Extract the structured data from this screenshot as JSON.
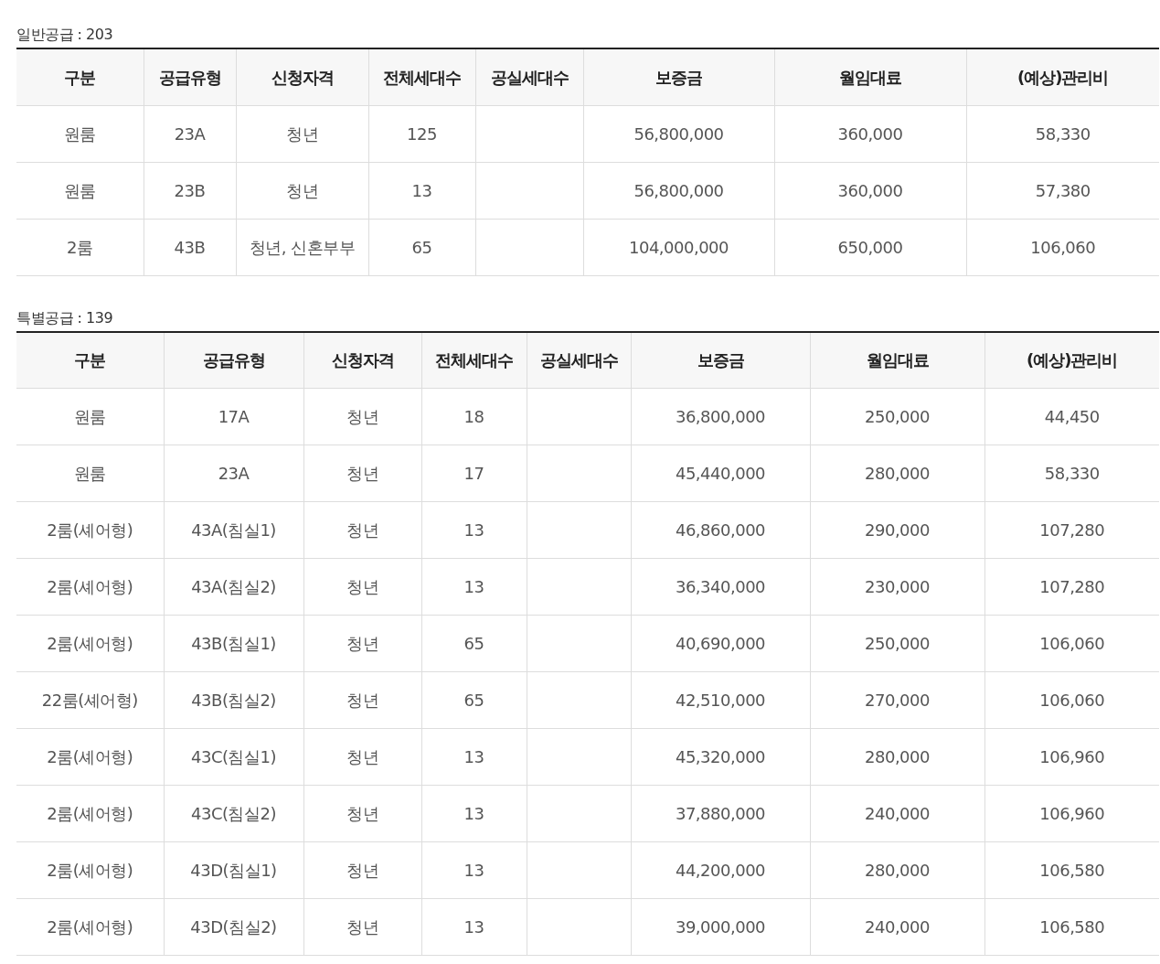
{
  "sections": [
    {
      "caption": "일반공급 : 203",
      "columns": [
        "구분",
        "공급유형",
        "신청자격",
        "전체세대수",
        "공실세대수",
        "보증금",
        "월임대료",
        "(예상)관리비"
      ],
      "rows": [
        {
          "category": "원룸",
          "supply_type": "23A",
          "eligibility": "청년",
          "total_units": "125",
          "deposit": "56,800,000",
          "monthly_rent": "360,000",
          "maintenance_fee": "58,330"
        },
        {
          "category": "원룸",
          "supply_type": "23B",
          "eligibility": "청년",
          "total_units": "13",
          "deposit": "56,800,000",
          "monthly_rent": "360,000",
          "maintenance_fee": "57,380"
        },
        {
          "category": "2룸",
          "supply_type": "43B",
          "eligibility": "청년, 신혼부부",
          "total_units": "65",
          "deposit": "104,000,000",
          "monthly_rent": "650,000",
          "maintenance_fee": "106,060"
        }
      ]
    },
    {
      "caption": "특별공급 : 139",
      "columns": [
        "구분",
        "공급유형",
        "신청자격",
        "전체세대수",
        "공실세대수",
        "보증금",
        "월임대료",
        "(예상)관리비"
      ],
      "rows": [
        {
          "category": "원룸",
          "supply_type": "17A",
          "eligibility": "청년",
          "total_units": "18",
          "deposit": "36,800,000",
          "monthly_rent": "250,000",
          "maintenance_fee": "44,450"
        },
        {
          "category": "원룸",
          "supply_type": "23A",
          "eligibility": "청년",
          "total_units": "17",
          "deposit": "45,440,000",
          "monthly_rent": "280,000",
          "maintenance_fee": "58,330"
        },
        {
          "category": "2룸(셰어형)",
          "supply_type": "43A(침실1)",
          "eligibility": "청년",
          "total_units": "13",
          "deposit": "46,860,000",
          "monthly_rent": "290,000",
          "maintenance_fee": "107,280"
        },
        {
          "category": "2룸(셰어형)",
          "supply_type": "43A(침실2)",
          "eligibility": "청년",
          "total_units": "13",
          "deposit": "36,340,000",
          "monthly_rent": "230,000",
          "maintenance_fee": "107,280"
        },
        {
          "category": "2룸(셰어형)",
          "supply_type": "43B(침실1)",
          "eligibility": "청년",
          "total_units": "65",
          "deposit": "40,690,000",
          "monthly_rent": "250,000",
          "maintenance_fee": "106,060"
        },
        {
          "category": "22룸(셰어형)",
          "supply_type": "43B(침실2)",
          "eligibility": "청년",
          "total_units": "65",
          "deposit": "42,510,000",
          "monthly_rent": "270,000",
          "maintenance_fee": "106,060"
        },
        {
          "category": "2룸(셰어형)",
          "supply_type": "43C(침실1)",
          "eligibility": "청년",
          "total_units": "13",
          "deposit": "45,320,000",
          "monthly_rent": "280,000",
          "maintenance_fee": "106,960"
        },
        {
          "category": "2룸(셰어형)",
          "supply_type": "43C(침실2)",
          "eligibility": "청년",
          "total_units": "13",
          "deposit": "37,880,000",
          "monthly_rent": "240,000",
          "maintenance_fee": "106,960"
        },
        {
          "category": "2룸(셰어형)",
          "supply_type": "43D(침실1)",
          "eligibility": "청년",
          "total_units": "13",
          "deposit": "44,200,000",
          "monthly_rent": "280,000",
          "maintenance_fee": "106,580"
        },
        {
          "category": "2룸(셰어형)",
          "supply_type": "43D(침실2)",
          "eligibility": "청년",
          "total_units": "13",
          "deposit": "39,000,000",
          "monthly_rent": "240,000",
          "maintenance_fee": "106,580"
        }
      ]
    }
  ]
}
